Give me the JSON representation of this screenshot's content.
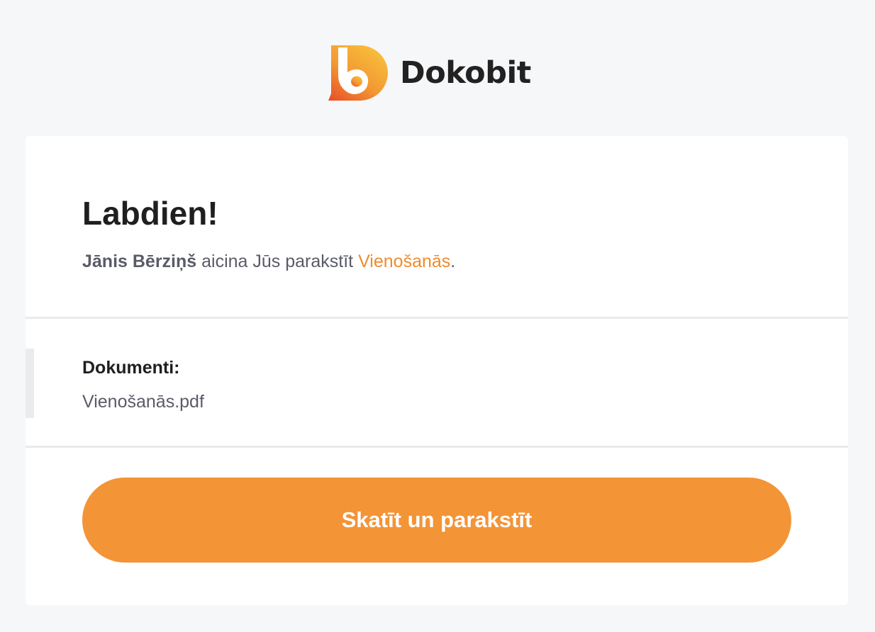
{
  "brand": {
    "name": "Dokobit",
    "logo_icon": "dokobit-logo-icon",
    "gradient_top": "#f9c23c",
    "gradient_bottom": "#e8542a"
  },
  "card": {
    "greeting": "Labdien!",
    "invite": {
      "sender": "Jānis Bērziņš",
      "text": " aicina Jūs parakstīt ",
      "document_link": "Vienošanās",
      "suffix": "."
    },
    "documents": {
      "heading": "Dokumenti:",
      "files": [
        "Vienošanās.pdf"
      ]
    },
    "cta_label": "Skatīt un parakstīt"
  },
  "colors": {
    "accent": "#f39436",
    "link": "#f08b2b",
    "background": "#f6f7f9",
    "text_dark": "#1f1f1f",
    "text_muted": "#5a5b68"
  }
}
